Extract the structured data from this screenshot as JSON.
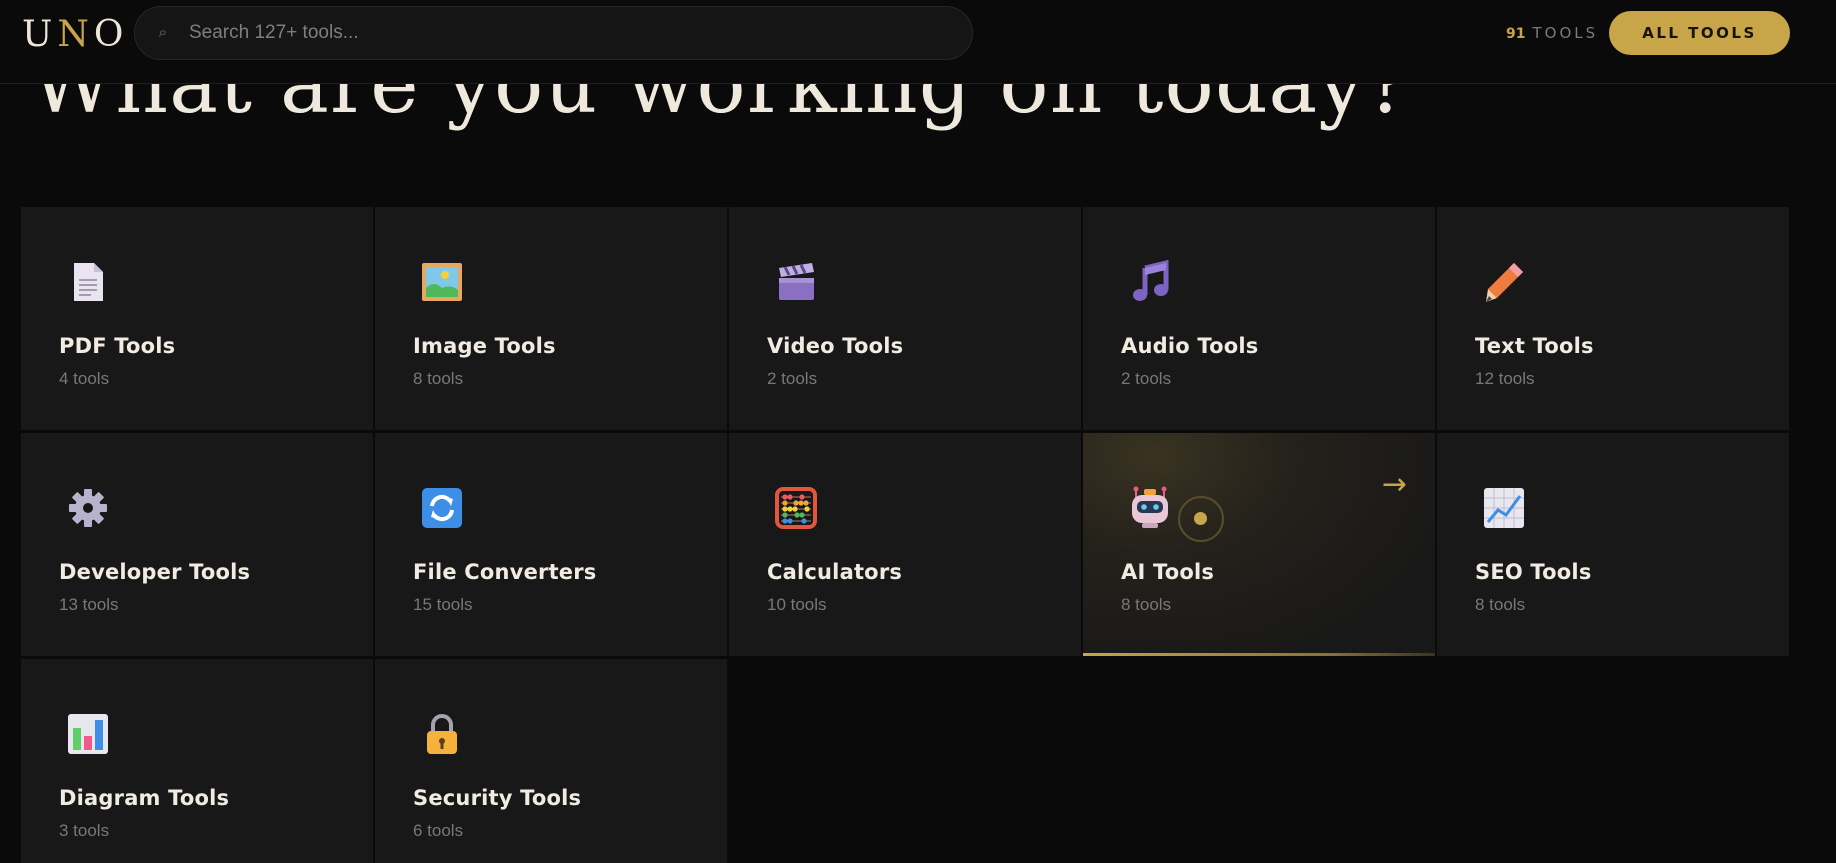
{
  "header": {
    "logo": {
      "first": "U",
      "accent": "N",
      "last": "O"
    },
    "search": {
      "placeholder": "Search 127+ tools..."
    },
    "tool_count": {
      "number": "91",
      "label": "TOOLS"
    },
    "all_tools_button": "ALL TOOLS"
  },
  "hero": {
    "title": "What are you working on today?"
  },
  "categories": [
    {
      "title": "PDF Tools",
      "count": "4 tools",
      "icon": "document-icon"
    },
    {
      "title": "Image Tools",
      "count": "8 tools",
      "icon": "picture-icon"
    },
    {
      "title": "Video Tools",
      "count": "2 tools",
      "icon": "clapperboard-icon"
    },
    {
      "title": "Audio Tools",
      "count": "2 tools",
      "icon": "music-note-icon"
    },
    {
      "title": "Text Tools",
      "count": "12 tools",
      "icon": "pencil-icon"
    },
    {
      "title": "Developer Tools",
      "count": "13 tools",
      "icon": "gear-icon"
    },
    {
      "title": "File Converters",
      "count": "15 tools",
      "icon": "refresh-icon"
    },
    {
      "title": "Calculators",
      "count": "10 tools",
      "icon": "abacus-icon"
    },
    {
      "title": "AI Tools",
      "count": "8 tools",
      "icon": "robot-icon",
      "active": true
    },
    {
      "title": "SEO Tools",
      "count": "8 tools",
      "icon": "trend-chart-icon"
    },
    {
      "title": "Diagram Tools",
      "count": "3 tools",
      "icon": "bar-chart-icon"
    },
    {
      "title": "Security Tools",
      "count": "6 tools",
      "icon": "lock-icon"
    }
  ],
  "colors": {
    "accent": "#c9a54a",
    "background": "#0a0a0a",
    "card": "#181818"
  }
}
